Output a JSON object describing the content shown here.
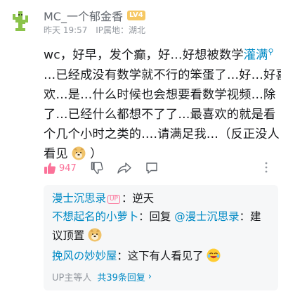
{
  "comment": {
    "username": "MC_一个郁金香",
    "level_badge": "LV4",
    "time": "昨天 19:57",
    "location": "IP属地：湖北",
    "text_part1": "wc，好早，发个癫，好…好想被数学",
    "keyword": "灌满",
    "text_line2": "…已经成没有数学就不行的笨蛋了…好…好喜",
    "text_line3": "欢…是…什么时候也会想要看数学视频…除",
    "text_line4": "了…已经什么都想不了了…最喜欢的就是看",
    "text_line5": "个几个小时之类的….请满足我…（反正没人",
    "text_line6a": "看见",
    "text_line6b": "）",
    "like_count": "947"
  },
  "replies": [
    {
      "name": "漫士沉思录",
      "is_up": true,
      "up_badge": "UP",
      "text": "：逆天"
    },
    {
      "name": "不想起名的小萝卜",
      "text_line1_a": "：回复 ",
      "mention": "@漫士沉思录",
      "text_line1_b": "：建",
      "text_line2": "议顶置"
    },
    {
      "name": "挽风の妙妙屋",
      "text": "：这下有人看见了"
    }
  ],
  "footer": {
    "up_others": "UP主等人",
    "total": "共39条回复",
    "chevron": "›"
  },
  "colors": {
    "link_blue": "#008ac5",
    "like_pink": "#fb7299",
    "level_badge": "#f6c863",
    "meta_gray": "#9499a0"
  }
}
